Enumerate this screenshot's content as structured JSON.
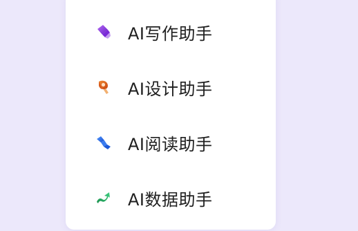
{
  "menu": {
    "items": [
      {
        "label": "AI写作助手",
        "icon": "writing-pen-icon",
        "color": "#8a3fe0"
      },
      {
        "label": "AI设计助手",
        "icon": "design-brush-icon",
        "color": "#e2651c"
      },
      {
        "label": "AI阅读助手",
        "icon": "reading-wave-icon",
        "color": "#2d6fe6"
      },
      {
        "label": "AI数据助手",
        "icon": "data-trend-icon",
        "color": "#20a05a"
      }
    ]
  }
}
